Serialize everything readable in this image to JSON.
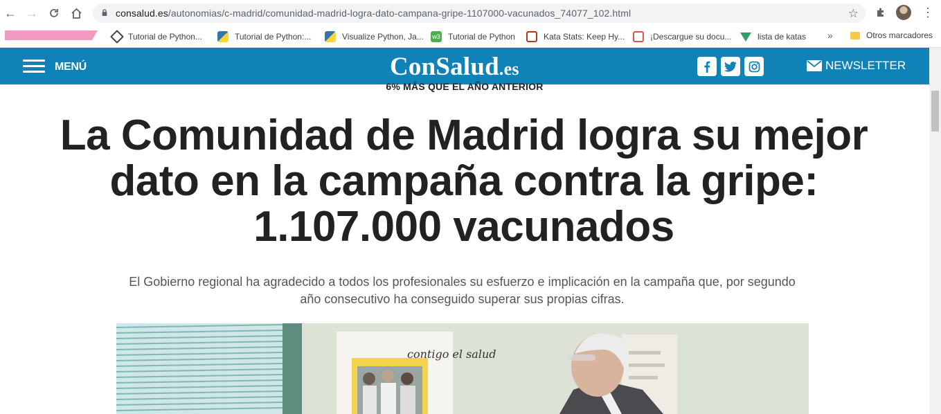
{
  "browser": {
    "url_host": "consalud.es",
    "url_path": "/autonomias/c-madrid/comunidad-madrid-logra-dato-campana-gripe-1107000-vacunados_74077_102.html",
    "bookmarks": [
      {
        "label": "Tutorial de Python...",
        "icon": "python-tutorial-icon",
        "color": "#444"
      },
      {
        "label": "Tutorial de Python:...",
        "icon": "python-icon",
        "color": "#3776ab"
      },
      {
        "label": "Visualize Python, Ja...",
        "icon": "python-icon",
        "color": "#3776ab"
      },
      {
        "label": "Tutorial de Python",
        "icon": "w3schools-icon",
        "color": "#4caf50"
      },
      {
        "label": "Kata Stats: Keep Hy...",
        "icon": "codewars-icon",
        "color": "#b1361e"
      },
      {
        "label": "¡Descargue su docu...",
        "icon": "pdf-icon",
        "color": "#d9534f"
      },
      {
        "label": "lista de katas",
        "icon": "vue-icon",
        "color": "#2f9c6c"
      }
    ],
    "other_bookmarks": "Otros marcadores",
    "more": "»"
  },
  "site": {
    "menu_label": "MENÚ",
    "logo_main": "ConSalud",
    "logo_suffix": ".es",
    "social": {
      "facebook": "f",
      "twitter": "t",
      "instagram": "ig"
    },
    "newsletter_label": "NEWSLETTER",
    "brand_color": "#0f82b8"
  },
  "article": {
    "kicker": "6% MÁS QUE EL AÑO ANTERIOR",
    "headline": "La Comunidad de Madrid logra su mejor dato en la campaña contra la gripe: 1.107.000 vacunados",
    "subtitle": "El Gobierno regional ha agradecido a todos los profesionales su esfuerzo e implicación en la campaña que, por segundo año consecutivo ha conseguido superar sus propias cifras.",
    "poster_text": "contigo el salud"
  }
}
